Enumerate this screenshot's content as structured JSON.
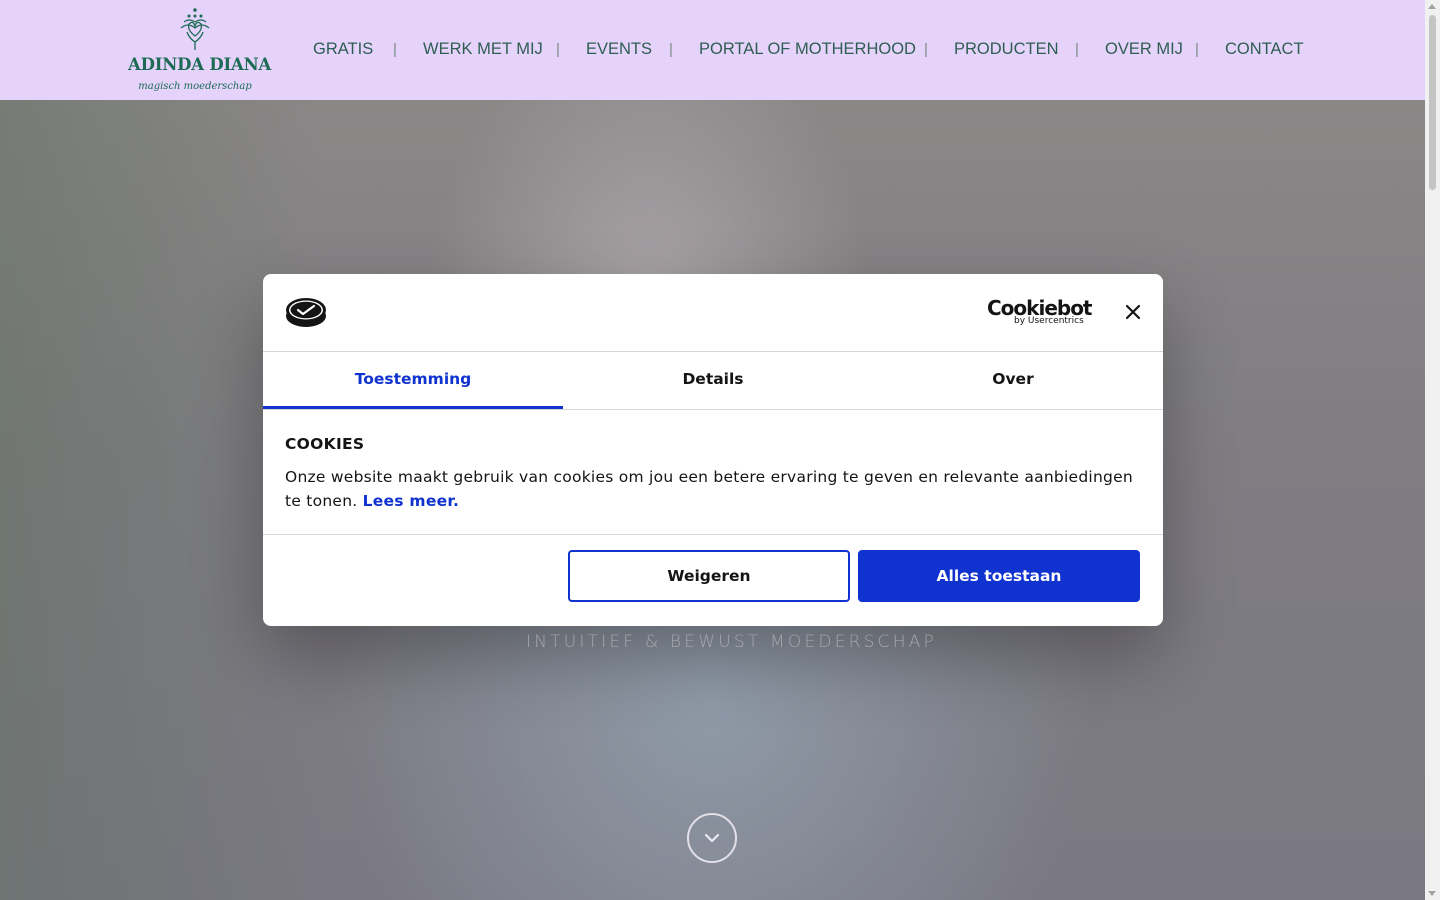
{
  "header": {
    "logo_title": "ADINDA DIANA",
    "logo_subtitle": "magisch moederschap",
    "nav": [
      "GRATIS",
      "WERK MET MIJ",
      "EVENTS",
      "PORTAL OF MOTHERHOOD",
      "PRODUCTEN",
      "OVER MIJ",
      "CONTACT"
    ],
    "nav_separator": "|"
  },
  "hero": {
    "tagline": "INTUITIEF & BEWUST MOEDERSCHAP",
    "scroll_icon": "chevron-down-icon"
  },
  "cookie_dialog": {
    "brand": "Cookiebot",
    "brand_sub": "by Usercentrics",
    "tabs": [
      "Toestemming",
      "Details",
      "Over"
    ],
    "active_tab": "Toestemming",
    "title": "COOKIES",
    "text": "Onze website maakt gebruik van cookies om jou een betere ervaring te geven en relevante aanbiedingen te tonen.",
    "link_text": "Lees meer.",
    "decline_label": "Weigeren",
    "allow_label": "Alles toestaan"
  },
  "colors": {
    "header_bg": "#e6d3fb",
    "nav_text": "#2e5d52",
    "accent": "#1032cf",
    "logo_green": "#1d6b54"
  }
}
